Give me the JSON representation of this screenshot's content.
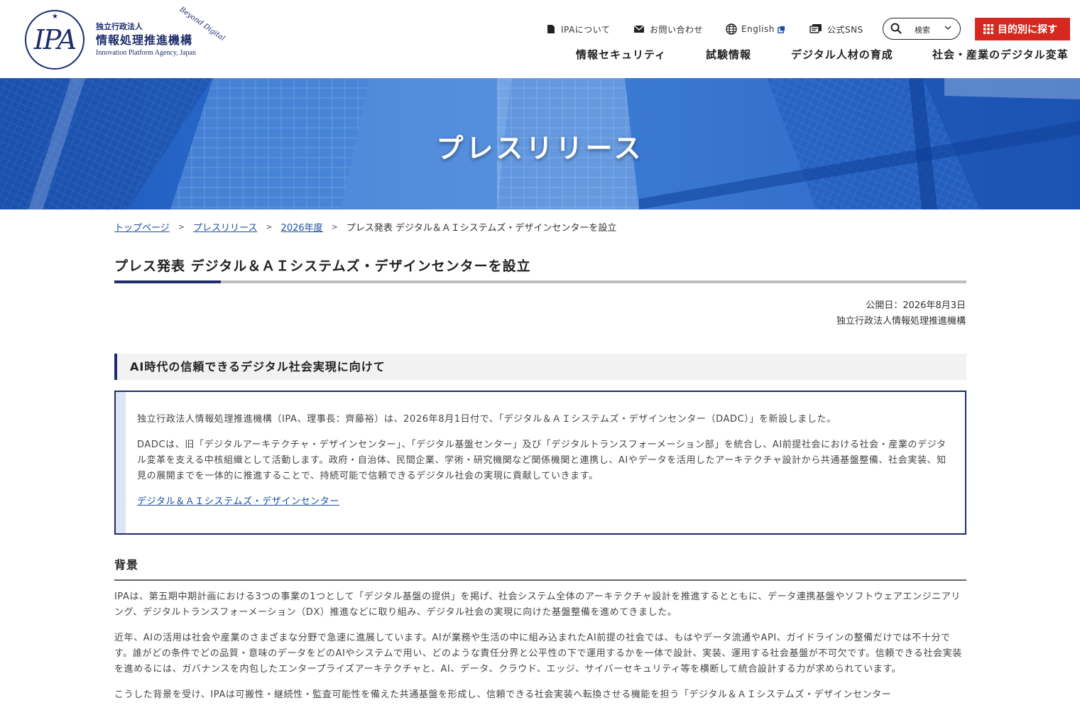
{
  "header": {
    "logo": {
      "mark": "IPA",
      "org_type": "独立行政法人",
      "org_name": "情報処理推進機構",
      "org_name_en": "Innovation Platform Agency, Japan",
      "tagline": "Beyond Digital"
    },
    "util_nav": {
      "about": "IPAについて",
      "contact": "お問い合わせ",
      "english": "English",
      "sns": "公式SNS",
      "search": "検索",
      "purpose": "目的別に探す"
    },
    "main_nav": [
      "情報セキュリティ",
      "試験情報",
      "デジタル人材の育成",
      "社会・産業のデジタル変革"
    ]
  },
  "hero": {
    "title": "プレスリリース"
  },
  "breadcrumb": {
    "items": [
      "トップページ",
      "プレスリリース",
      "2026年度"
    ],
    "current": "プレス発表 デジタル＆ＡＩシステムズ・デザインセンターを設立"
  },
  "article": {
    "title": "プレス発表 デジタル＆ＡＩシステムズ・デザインセンターを設立",
    "published": "公開日：2026年8月3日",
    "publisher": "独立行政法人情報処理推進機構",
    "section_heading": "AI時代の信頼できるデジタル社会実現に向けて",
    "box_para1": "独立行政法人情報処理推進機構（IPA、理事長：齊藤裕）は、2026年8月1日付で、「デジタル＆ＡＩシステムズ・デザインセンター（DADC）」を新設しました。",
    "box_para2": "DADCは、旧「デジタルアーキテクチャ・デザインセンター」、「デジタル基盤センター」及び「デジタルトランスフォーメーション部」を統合し、AI前提社会における社会・産業のデジタル変革を支える中核組織として活動します。政府・自治体、民間企業、学術・研究機関など関係機関と連携し、AIやデータを活用したアーキテクチャ設計から共通基盤整備、社会実装、知見の展開までを一体的に推進することで、持続可能で信頼できるデジタル社会の実現に貢献していきます。",
    "box_link": "デジタル＆ＡＩシステムズ・デザインセンター",
    "background_heading": "背景",
    "background_para1": "IPAは、第五期中期計画における3つの事業の1つとして「デジタル基盤の提供」を掲げ、社会システム全体のアーキテクチャ設計を推進するとともに、データ連携基盤やソフトウェアエンジニアリング、デジタルトランスフォーメーション（DX）推進などに取り組み、デジタル社会の実現に向けた基盤整備を進めてきました。",
    "background_para2": "近年、AIの活用は社会や産業のさまざまな分野で急速に進展しています。AIが業務や生活の中に組み込まれたAI前提の社会では、もはやデータ流通やAPI、ガイドラインの整備だけでは不十分です。誰がどの条件でどの品質・意味のデータをどのAIやシステムで用い、どのような責任分界と公平性の下で運用するかを一体で設計、実装、運用する社会基盤が不可欠です。信頼できる社会実装を進めるには、ガバナンスを内包したエンタープライズアーキテクチャと、AI、データ、クラウド、エッジ、サイバーセキュリティ等を横断して統合設計する力が求められています。",
    "background_para3": "こうした背景を受け、IPAは可搬性・継続性・監査可能性を備えた共通基盤を形成し、信頼できる社会実装へ転換させる機能を担う「デジタル＆ＡＩシステムズ・デザインセンター"
  },
  "colors": {
    "navy": "#1d2c6b",
    "accent_red": "#d6281f",
    "link": "#1d4fa0"
  }
}
